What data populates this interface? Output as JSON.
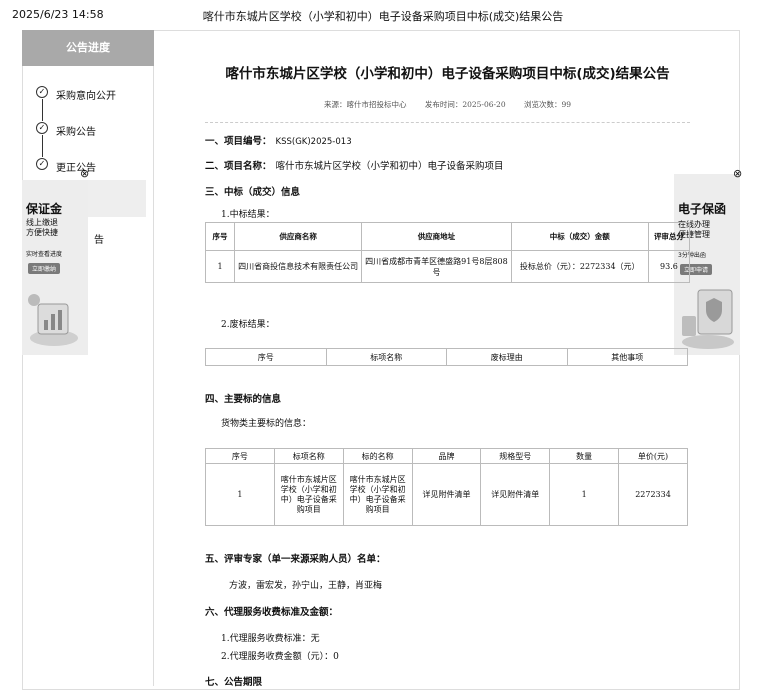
{
  "print_header": {
    "datetime": "2025/6/23 14:58",
    "title": "喀什市东城片区学校（小学和初中）电子设备采购项目中标(成交)结果公告"
  },
  "sidebar": {
    "heading": "公告进度",
    "steps": [
      {
        "label": "采购意向公开",
        "icon": "check-circle-icon"
      },
      {
        "label": "采购公告",
        "icon": "check-circle-icon"
      },
      {
        "label": "更正公告",
        "icon": "check-circle-icon"
      },
      {
        "label": "告",
        "icon": ""
      },
      {
        "label": "告",
        "icon": ""
      }
    ]
  },
  "ad_left": {
    "title": "保证金",
    "sub1": "线上缴退",
    "sub2": "方便快捷",
    "sub3": "实时查看进度",
    "button": "立即缴纳",
    "close": "⊗"
  },
  "ad_right": {
    "title": "电子保函",
    "sub1": "在线办理",
    "sub2": "便捷管理",
    "sub3": "3分钟出函",
    "button": "立即申请",
    "close": "⊗"
  },
  "doc": {
    "title": "喀什市东城片区学校（小学和初中）电子设备采购项目中标(成交)结果公告",
    "source": "来源：喀什市招投标中心",
    "publish_time": "发布时间：2025-06-20",
    "views": "浏览次数：99",
    "sec1_label": "一、项目编号：",
    "sec1_value": "KSS(GK)2025-013",
    "sec2_label": "二、项目名称：",
    "sec2_value": "喀什市东城片区学校（小学和初中）电子设备采购项目",
    "sec3_label": "三、中标（成交）信息",
    "win_result_label": "1.中标结果：",
    "win_table": {
      "headers": [
        "序号",
        "供应商名称",
        "供应商地址",
        "中标（成交）金额",
        "评审总分"
      ],
      "row": [
        "1",
        "四川省商投信息技术有限责任公司",
        "四川省成都市青羊区德盛路91号8层808号",
        "投标总价（元）：2272334（元）",
        "93.6"
      ]
    },
    "void_result_label": "2.废标结果：",
    "void_table_headers": [
      "序号",
      "标项名称",
      "废标理由",
      "其他事项"
    ],
    "sec4_label": "四、主要标的信息",
    "goods_label": "货物类主要标的信息：",
    "goods_table": {
      "headers": [
        "序号",
        "标项名称",
        "标的名称",
        "品牌",
        "规格型号",
        "数量",
        "单价(元)"
      ],
      "row": [
        "1",
        "喀什市东城片区学校（小学和初中）电子设备采购项目",
        "喀什市东城片区学校（小学和初中）电子设备采购项目",
        "详见附件清单",
        "详见附件清单",
        "1",
        "2272334"
      ]
    },
    "sec5_label": "五、评审专家（单一来源采购人员）名单：",
    "experts": "方波，雷宏发，孙宁山，王静，肖亚梅",
    "sec6_label": "六、代理服务收费标准及金额：",
    "fee_standard": "1.代理服务收费标准：无",
    "fee_amount": "2.代理服务收费金额（元）：0",
    "sec7_label": "七、公告期限"
  }
}
